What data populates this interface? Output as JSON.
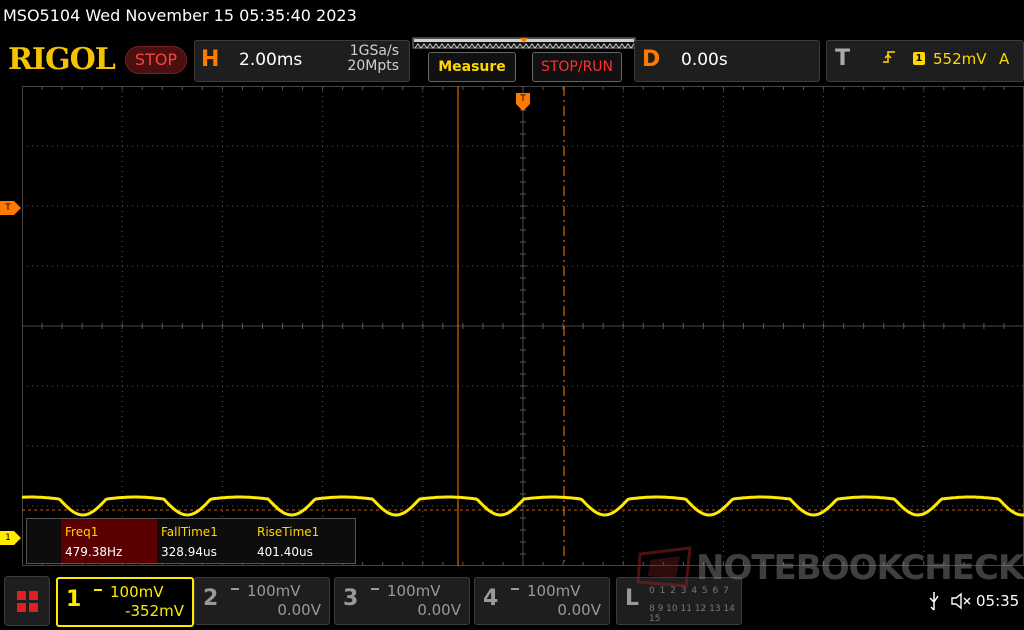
{
  "title": "MSO5104  Wed November 15 05:35:40 2023",
  "brand": "RIGOL",
  "run_state": "STOP",
  "horizontal": {
    "letter": "H",
    "timebase": "2.00ms",
    "sample_rate": "1GSa/s",
    "memory_depth": "20Mpts"
  },
  "buttons": {
    "measure": "Measure",
    "stop_run": "STOP/RUN"
  },
  "delay": {
    "letter": "D",
    "value": "0.00s"
  },
  "trigger": {
    "letter": "T",
    "source": "1",
    "level": "552mV",
    "mode": "A"
  },
  "markers": {
    "trigger_top": "T",
    "trigger_level": "T",
    "ch1": "1"
  },
  "measurements": [
    {
      "name": "Freq1",
      "value": "479.38Hz"
    },
    {
      "name": "FallTime1",
      "value": "328.94us"
    },
    {
      "name": "RiseTime1",
      "value": "401.40us"
    }
  ],
  "channels": [
    {
      "num": "1",
      "scale": "100mV",
      "offset": "-352mV",
      "active": true
    },
    {
      "num": "2",
      "scale": "100mV",
      "offset": "0.00V",
      "active": false
    },
    {
      "num": "3",
      "scale": "100mV",
      "offset": "0.00V",
      "active": false
    },
    {
      "num": "4",
      "scale": "100mV",
      "offset": "0.00V",
      "active": false
    }
  ],
  "logic": {
    "letter": "L",
    "row1": "0 1 2 3 4 5 6 7",
    "row2": "8 9 10 11 12 13 14 15"
  },
  "watermark": "NOTEBOOKCHECK",
  "status": {
    "time": "05:35"
  },
  "colors": {
    "ch1": "#ffea00",
    "accent": "#ff7a00",
    "stop": "#ff3030",
    "grid": "#5a5a5a"
  },
  "icons": {
    "usb": "usb-icon",
    "sound": "speaker-muted-icon",
    "menu": "menu-grid-icon"
  }
}
